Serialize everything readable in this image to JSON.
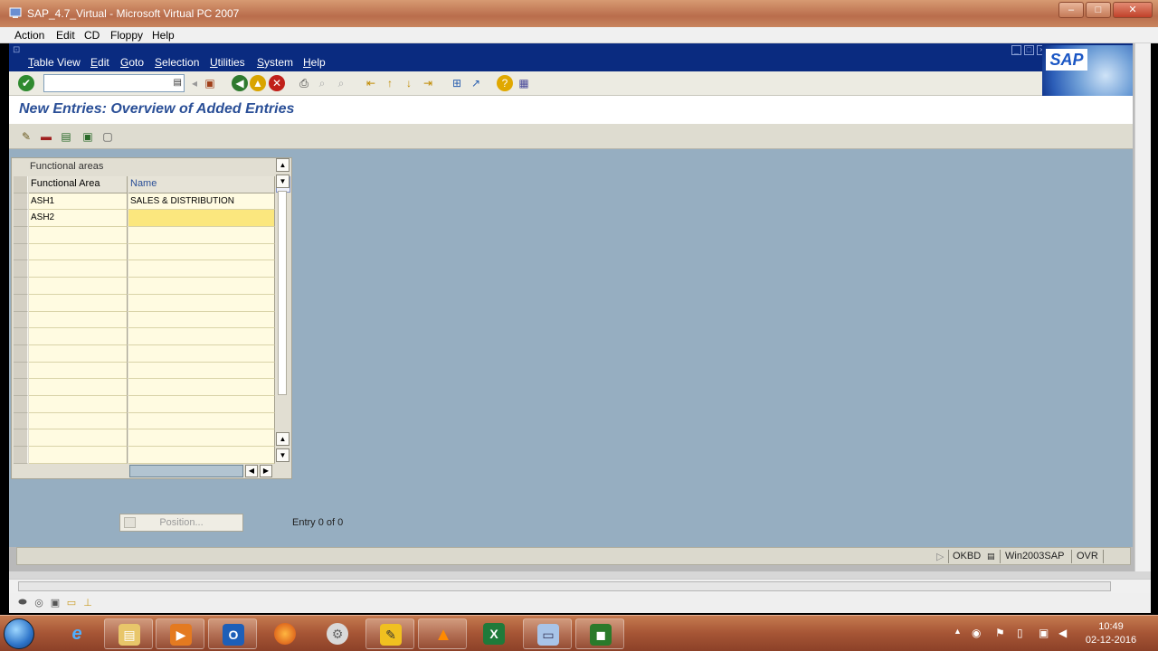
{
  "window": {
    "title": "SAP_4.7_Virtual - Microsoft Virtual PC 2007",
    "controls": {
      "minimize": "–",
      "maximize": "□",
      "close": "✕"
    }
  },
  "vpc_menu": [
    "Action",
    "Edit",
    "CD",
    "Floppy",
    "Help"
  ],
  "sap": {
    "menu": [
      "Table View",
      "Edit",
      "Goto",
      "Selection",
      "Utilities",
      "System",
      "Help"
    ],
    "logo": "SAP",
    "command_field": {
      "value": ""
    },
    "page_title": "New Entries: Overview of Added Entries",
    "table": {
      "caption": "Functional areas",
      "headers": [
        "Functional Area",
        "Name"
      ],
      "rows": [
        {
          "area": "ASH1",
          "name": "SALES & DISTRIBUTION"
        },
        {
          "area": "ASH2",
          "name": ""
        }
      ],
      "empty_rows": 14
    },
    "position_button": "Position...",
    "entry_text": "Entry 0 of 0",
    "status": {
      "transaction": "OKBD",
      "server": "Win2003SAP",
      "mode": "OVR"
    },
    "colors": {
      "menubar": "#0a2b80",
      "workarea": "#96aec1",
      "title": "#2a4f97",
      "cell": "#fffbe1",
      "active_cell": "#fbe77e"
    }
  },
  "taskbar": {
    "apps": [
      "Windows Explorer",
      "Internet Explorer",
      "File Manager",
      "Windows Media Player",
      "Outlook",
      "Firefox",
      "Settings",
      "Sticky Tool",
      "VLC",
      "Excel",
      "Virtual PC",
      "Camera"
    ],
    "clock": {
      "time": "10:49",
      "date": "02-12-2016"
    }
  }
}
